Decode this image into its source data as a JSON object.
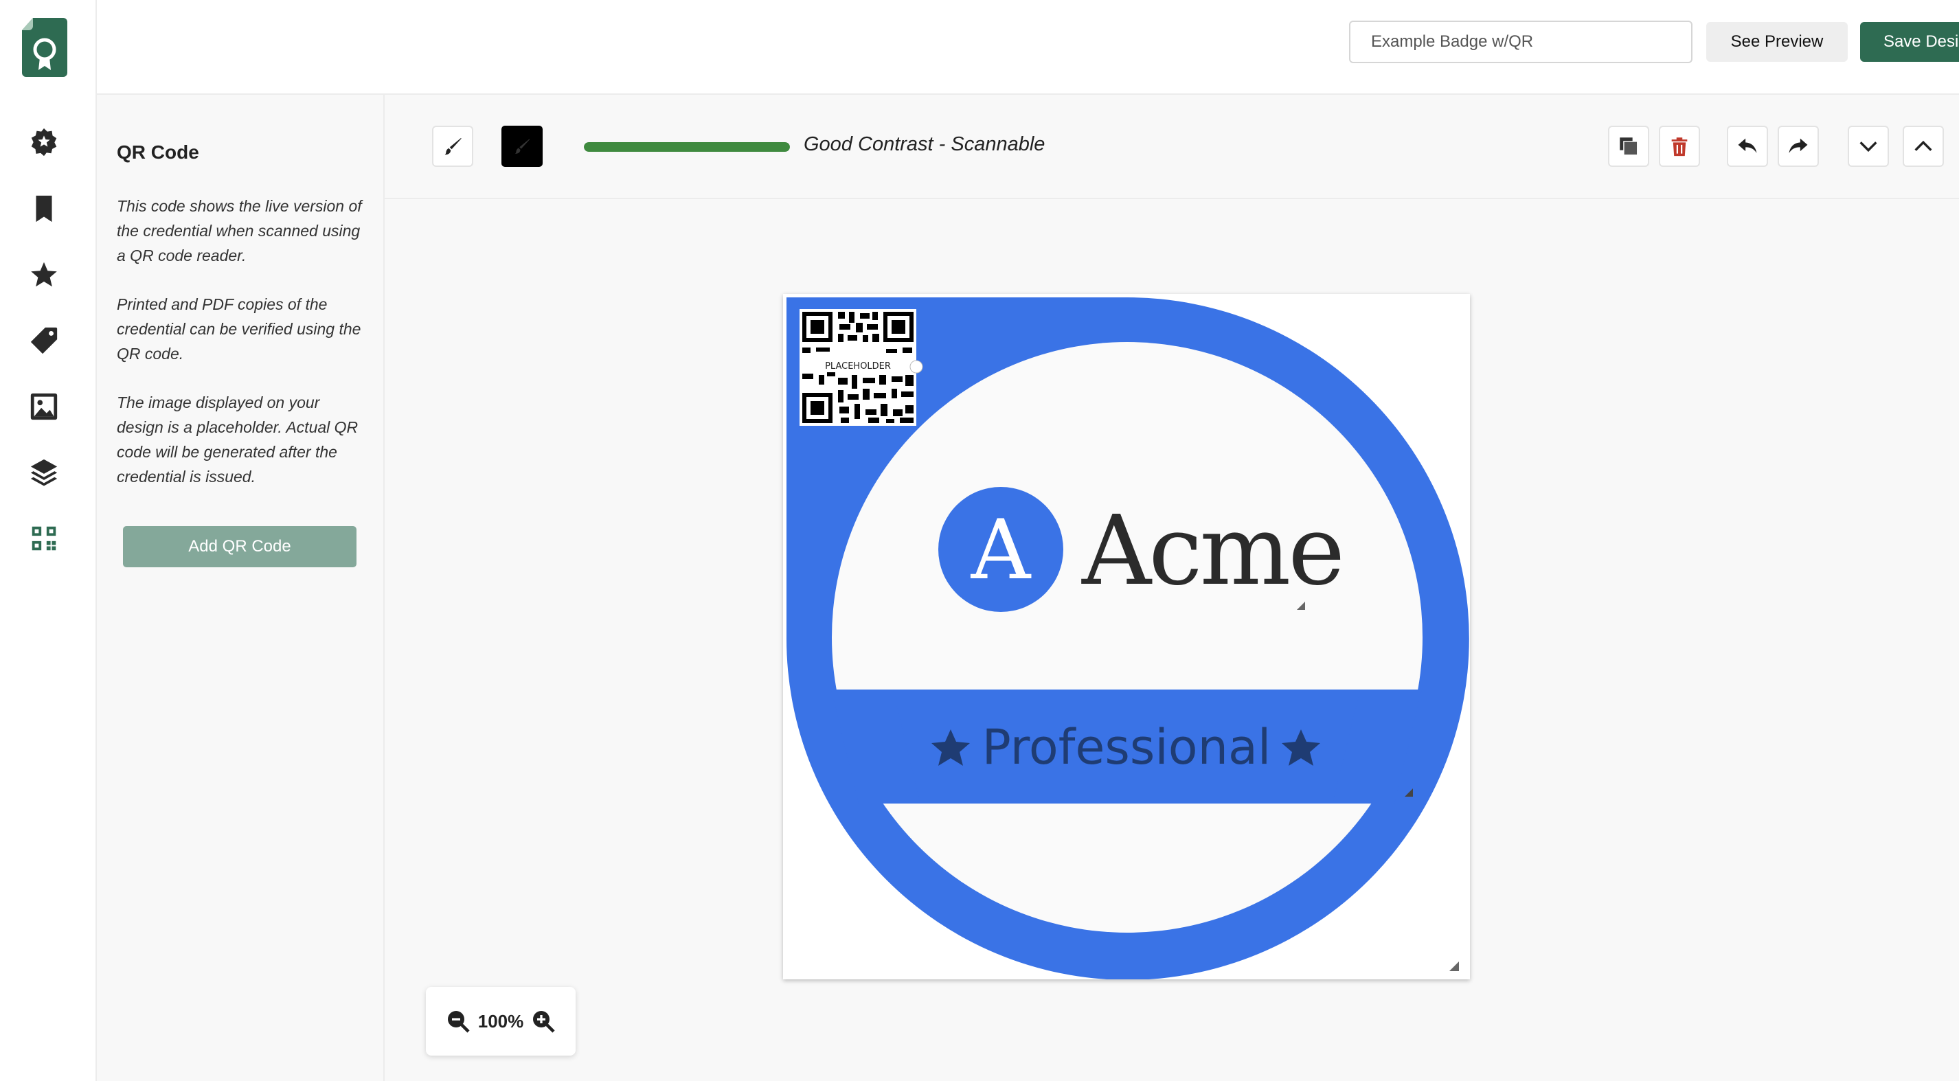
{
  "header": {
    "design_name_value": "Example Badge w/QR",
    "preview_label": "See Preview",
    "save_label": "Save Design"
  },
  "sidebar": {
    "items": [
      {
        "name": "badge-shapes",
        "icon": "badge-icon"
      },
      {
        "name": "ribbons",
        "icon": "bookmark-icon"
      },
      {
        "name": "icons",
        "icon": "star-icon"
      },
      {
        "name": "labels",
        "icon": "tag-icon"
      },
      {
        "name": "images",
        "icon": "image-icon"
      },
      {
        "name": "layers",
        "icon": "layers-icon"
      },
      {
        "name": "qr-code",
        "icon": "qr-icon",
        "active": true
      }
    ]
  },
  "panel": {
    "title": "QR Code",
    "paragraphs": [
      "This code shows the live version of the credential when scanned using a QR code reader.",
      "Printed and PDF copies of the credential can be verified using the QR code.",
      "The image displayed on your design is a placeholder. Actual QR code will be generated after the credential is issued."
    ],
    "add_button_label": "Add QR Code"
  },
  "toolbar": {
    "contrast_label": "Good Contrast - Scannable",
    "contrast_level": 1.0,
    "swatch_color": "#000000"
  },
  "badge": {
    "qr_placeholder_text": "PLACEHOLDER",
    "logo_letter": "A",
    "brand_name": "Acme",
    "ribbon_text": "Professional",
    "primary_color": "#3a73e6",
    "ribbon_text_color": "#1f3c73",
    "background_color": "#fafafa"
  },
  "zoom": {
    "value": "100%"
  },
  "colors": {
    "accent": "#2e6b52",
    "add_button": "#84a89a",
    "contrast_good": "#3f8a3f",
    "delete": "#c0392b"
  }
}
